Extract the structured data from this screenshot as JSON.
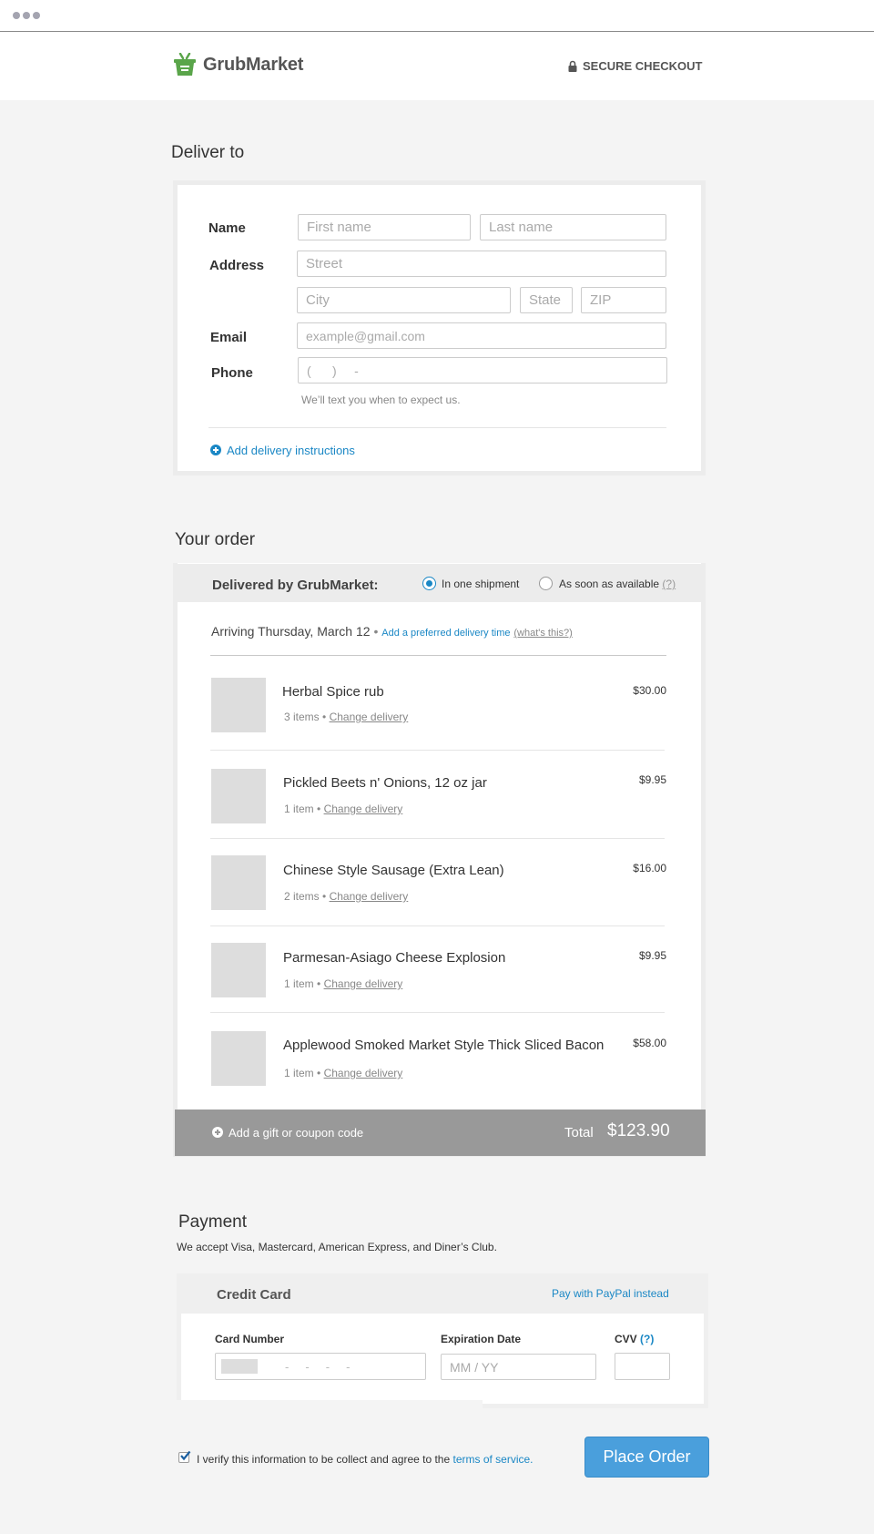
{
  "brand": {
    "name": "GrubMarket",
    "color": "#5aa54a",
    "accent": "#1a87c5"
  },
  "header": {
    "secure_label": "SECURE CHECKOUT"
  },
  "deliver": {
    "title": "Deliver to",
    "name_label": "Name",
    "address_label": "Address",
    "email_label": "Email",
    "phone_label": "Phone",
    "first_name_placeholder": "First name",
    "last_name_placeholder": "Last name",
    "street_placeholder": "Street",
    "city_placeholder": "City",
    "state_placeholder": "State",
    "zip_placeholder": "ZIP",
    "email_placeholder": "example@gmail.com",
    "phone_placeholder": "(      )     -",
    "phone_note": "We’ll text you when to expect us.",
    "add_instructions": "Add delivery instructions"
  },
  "order": {
    "title": "Your order",
    "delivered_by": "Delivered by GrubMarket:",
    "option_one": "In one shipment",
    "option_two": "As soon as available",
    "option_two_help": "(?)",
    "arriving": "Arriving Thursday, March 12",
    "preferred_time": "Add a preferred delivery time",
    "whats_this": "(what's this?)",
    "change_delivery": "Change delivery",
    "items": [
      {
        "name": "Herbal Spice rub",
        "qty": "3 items",
        "price": "$30.00"
      },
      {
        "name": "Pickled Beets n' Onions, 12 oz jar",
        "qty": "1 item",
        "price": "$9.95"
      },
      {
        "name": "Chinese Style Sausage (Extra Lean)",
        "qty": "2 items",
        "price": "$16.00"
      },
      {
        "name": "Parmesan-Asiago Cheese Explosion",
        "qty": "1 item",
        "price": "$9.95"
      },
      {
        "name": "Applewood Smoked Market Style Thick Sliced Bacon",
        "qty": "1 item",
        "price": "$58.00"
      }
    ],
    "coupon": "Add a gift or coupon code",
    "total_label": "Total",
    "total_value": "$123.90"
  },
  "payment": {
    "title": "Payment",
    "accepted": "We accept Visa, Mastercard, American Express, and Diner’s Club.",
    "credit_card": "Credit Card",
    "paypal": "Pay with PayPal instead",
    "card_number_label": "Card Number",
    "card_number_placeholder": "-     -     -     -",
    "expiration_label": "Expiration Date",
    "expiration_placeholder": "MM / YY",
    "cvv_label": "CVV",
    "cvv_help": "(?)"
  },
  "footer": {
    "verify_text": "I verify this information to be collect and agree to the",
    "terms": "terms of service.",
    "place_order": "Place Order"
  }
}
